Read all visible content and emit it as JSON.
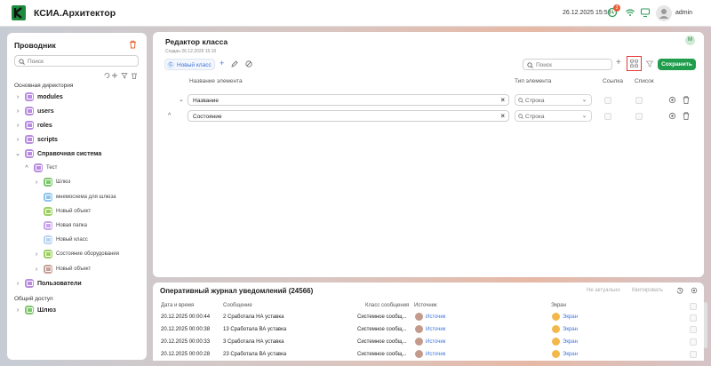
{
  "header": {
    "title": "КСИА.Архитектор",
    "datetime": "26.12.2025 15:58",
    "notif_count": "3",
    "user": "admin"
  },
  "explorer": {
    "title": "Проводник",
    "search_placeholder": "Поиск",
    "main_section": "Основная директория",
    "items": [
      {
        "label": "modules"
      },
      {
        "label": "users"
      },
      {
        "label": "roles"
      },
      {
        "label": "scripts"
      },
      {
        "label": "Справочная система"
      },
      {
        "label": "Тест"
      },
      {
        "label": "Шлюз"
      },
      {
        "label": "мнемосхема для шлюза"
      },
      {
        "label": "Новый объект"
      },
      {
        "label": "Новая папка"
      },
      {
        "label": "Новый класс"
      },
      {
        "label": "Состояние оборудования"
      },
      {
        "label": "Новый объект"
      },
      {
        "label": "Пользователи"
      }
    ],
    "shared_section": "Общий доступ",
    "shared_items": [
      {
        "label": "Шлюз"
      }
    ]
  },
  "editor": {
    "title": "Редактор класса",
    "created": "Создан 26.12.2025 15:10",
    "avatar_letter": "M",
    "class_tab": "Новый класс",
    "search_placeholder": "Поиск",
    "save": "Сохранить",
    "columns": {
      "name": "Название элемента",
      "type": "Тип элемента",
      "ref": "Ссылка",
      "list": "Список"
    },
    "rows": [
      {
        "name": "Название",
        "type": "Строка"
      },
      {
        "name": "Состояние",
        "type": "Строка"
      }
    ]
  },
  "journal": {
    "title": "Оперативный журнал уведомлений (24566)",
    "btn_irrelevant": "Не актуально",
    "btn_ack": "Квитировать",
    "columns": {
      "datetime": "Дата и время",
      "message": "Сообщение",
      "class": "Класс сообщения",
      "source": "Источник",
      "screen": "Экран"
    },
    "rows": [
      {
        "datetime": "20.12.2025 00:00:44",
        "message": "2 Сработала НА уставка",
        "class": "Системное сообщ...",
        "source": "Источик",
        "screen": "Экран"
      },
      {
        "datetime": "20.12.2025 00:00:38",
        "message": "13 Сработала ВА уставка",
        "class": "Системное сообщ...",
        "source": "Источик",
        "screen": "Экран"
      },
      {
        "datetime": "20.12.2025 00:00:33",
        "message": "3 Сработала НА уставка",
        "class": "Системное сообщ...",
        "source": "Источик",
        "screen": "Экран"
      },
      {
        "datetime": "20.12.2025 00:00:28",
        "message": "23 Сработала ВА уставка",
        "class": "Системное сообщ...",
        "source": "Источик",
        "screen": "Экран"
      }
    ]
  },
  "colors": {
    "accent_green": "#1f9d4c",
    "folder_purple": "#b98ce0",
    "link_blue": "#3d74d9",
    "highlight_red": "#e53935"
  }
}
